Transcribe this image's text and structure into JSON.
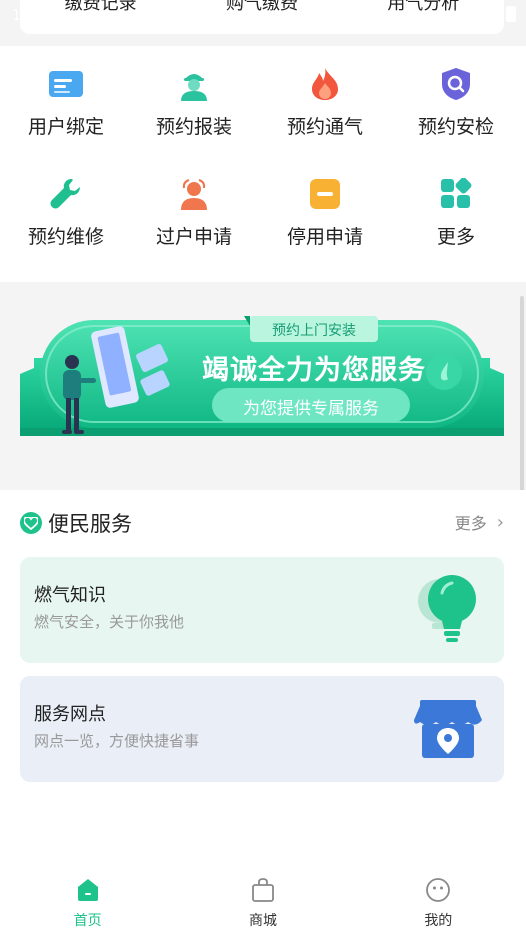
{
  "status": {
    "left_text": "1"
  },
  "top_tabs": [
    "缴费记录",
    "购气缴费",
    "用气分析"
  ],
  "grid": [
    {
      "label": "用户绑定",
      "icon": "id-card-icon"
    },
    {
      "label": "预约报装",
      "icon": "worker-icon"
    },
    {
      "label": "预约通气",
      "icon": "flame-icon"
    },
    {
      "label": "预约安检",
      "icon": "shield-search-icon"
    },
    {
      "label": "预约维修",
      "icon": "wrench-icon"
    },
    {
      "label": "过户申请",
      "icon": "transfer-user-icon"
    },
    {
      "label": "停用申请",
      "icon": "stop-icon"
    },
    {
      "label": "更多",
      "icon": "apps-icon"
    }
  ],
  "banner": {
    "tag": "预约上门安装",
    "headline": "竭诚全力为您服务",
    "sub": "为您提供专属服务"
  },
  "section": {
    "title": "便民服务",
    "more": "更多"
  },
  "cards": [
    {
      "title": "燃气知识",
      "subtitle": "燃气安全，关于你我他",
      "icon": "lightbulb-icon"
    },
    {
      "title": "服务网点",
      "subtitle": "网点一览，方便快捷省事",
      "icon": "store-location-icon"
    }
  ],
  "nav": [
    {
      "label": "首页",
      "icon": "home-icon",
      "active": true
    },
    {
      "label": "商城",
      "icon": "shopping-bag-icon",
      "active": false
    },
    {
      "label": "我的",
      "icon": "user-face-icon",
      "active": false
    }
  ],
  "colors": {
    "accent": "#1ec28b",
    "card1_bg": "#e7f6f1",
    "card2_bg": "#e9eef7"
  }
}
